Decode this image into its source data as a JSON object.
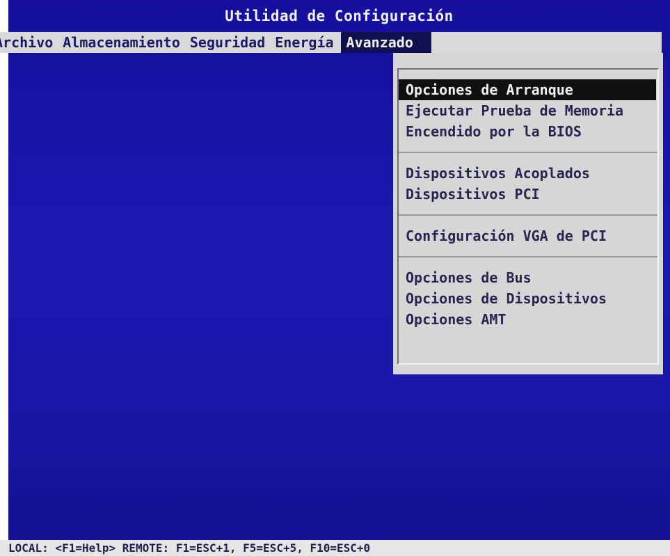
{
  "window": {
    "title": "Utilidad de Configuración"
  },
  "menu": {
    "items": [
      {
        "label": "Archivo"
      },
      {
        "label": "Almacenamiento"
      },
      {
        "label": "Seguridad"
      },
      {
        "label": "Energía"
      },
      {
        "label": "Avanzado",
        "active": true
      }
    ]
  },
  "dropdown": {
    "groups": [
      {
        "options": [
          {
            "label": "Opciones de Arranque",
            "selected": true
          },
          {
            "label": "Ejecutar Prueba de Memoria"
          },
          {
            "label": "Encendido por la BIOS"
          }
        ]
      },
      {
        "options": [
          {
            "label": "Dispositivos Acoplados"
          },
          {
            "label": "Dispositivos PCI"
          }
        ]
      },
      {
        "options": [
          {
            "label": "Configuración VGA de PCI"
          }
        ]
      },
      {
        "options": [
          {
            "label": "Opciones de Bus"
          },
          {
            "label": "Opciones de Dispositivos"
          },
          {
            "label": "Opciones AMT"
          }
        ]
      }
    ]
  },
  "status_bar": {
    "text": "LOCAL: <F1=Help> REMOTE: F1=ESC+1, F5=ESC+5, F10=ESC+0"
  },
  "colors": {
    "screen_background": "#1a15a8",
    "menu_background": "#d9d9d9",
    "active_menu_background": "#101050",
    "selected_option_background": "#101010"
  }
}
